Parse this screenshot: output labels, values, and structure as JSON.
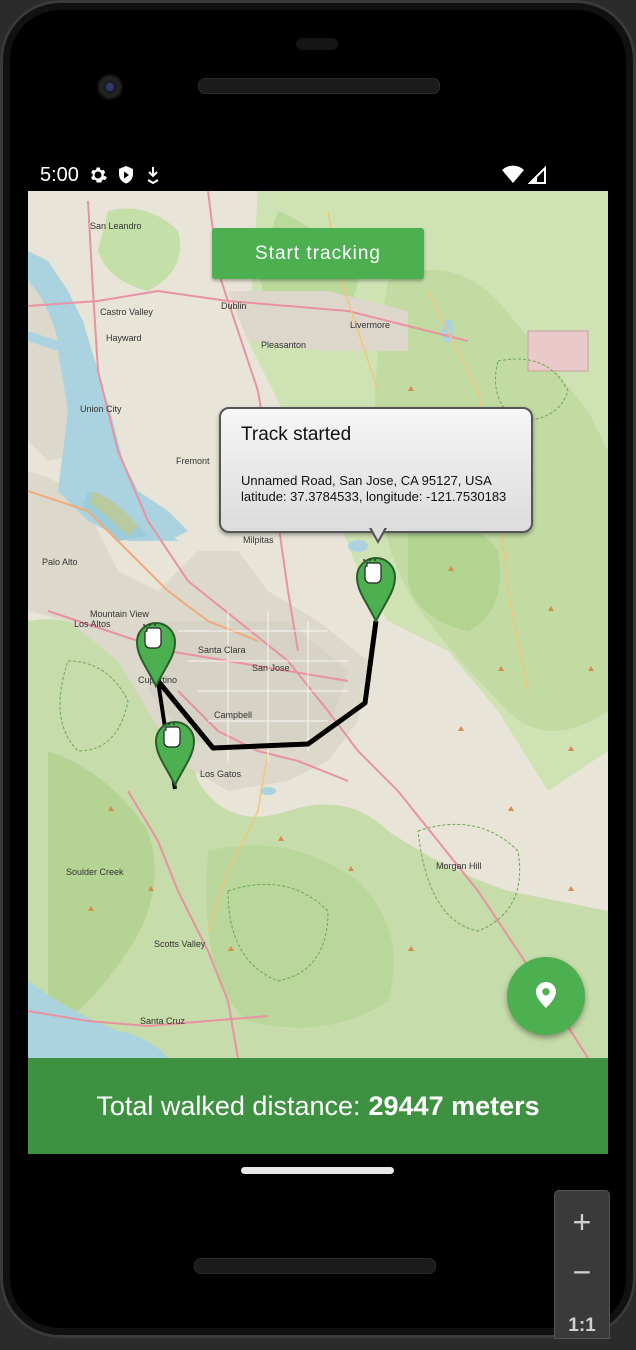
{
  "status_bar": {
    "time": "5:00",
    "left_icons": [
      "gear-icon",
      "shield-icon",
      "download-icon"
    ],
    "right_icons": [
      "wifi-icon",
      "signal-icon"
    ]
  },
  "map": {
    "place_labels": [
      "Hayward",
      "Fremont",
      "Milpitas",
      "Palo Alto",
      "Mountain View",
      "Santa Clara",
      "San Jose",
      "Cupertino",
      "Campbell",
      "Los Gatos",
      "Pleasanton",
      "Livermore",
      "Dublin",
      "Union City",
      "Los Altos",
      "Santa Cruz",
      "Scotts Valley",
      "Soulder Creek",
      "Morgan Hill",
      "San Leandro",
      "Castro Valley"
    ]
  },
  "start_button": {
    "label": "Start tracking"
  },
  "info_bubble": {
    "title": "Track started",
    "description": "Unnamed Road, San Jose, CA 95127, USA latitude: 37.3784533, longitude: -121.7530183"
  },
  "fab": {
    "icon": "location-pin-icon"
  },
  "bottom_bar": {
    "prefix": "Total walked distance:",
    "value": "29447 meters"
  },
  "zoom": {
    "in": "+",
    "out": "−",
    "reset": "1:1"
  },
  "colors": {
    "accent": "#4caf50",
    "bottom_bar": "#3d9140",
    "track": "#000000"
  }
}
